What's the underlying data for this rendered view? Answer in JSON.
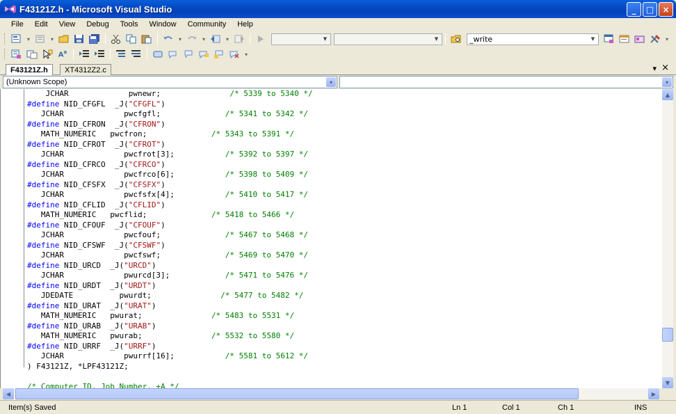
{
  "window": {
    "title": "F43121Z.h - Microsoft Visual Studio",
    "controls": [
      "_",
      "□",
      "×"
    ]
  },
  "menu": [
    "File",
    "Edit",
    "View",
    "Debug",
    "Tools",
    "Window",
    "Community",
    "Help"
  ],
  "toolbar1": {
    "find_combo_value": "_write"
  },
  "tabs": {
    "active": "F43121Z.h",
    "inactive": "XT4312Z2.c",
    "dropdown": "▾",
    "close": "×"
  },
  "scope": {
    "left_value": "(Unknown Scope)",
    "right_value": "",
    "dd_glyph": "▾"
  },
  "code_lines": [
    [
      [
        "",
        "    JCHAR             pwnewr;               "
      ],
      [
        "cmt",
        "/* 5339 to 5340 */"
      ]
    ],
    [
      [
        "kw",
        "#define"
      ],
      [
        "",
        " NID_CFGFL  _J("
      ],
      [
        "str",
        "\"CFGFL\""
      ],
      [
        "",
        ")"
      ]
    ],
    [
      [
        "",
        "   JCHAR             pwcfgfl;              "
      ],
      [
        "cmt",
        "/* 5341 to 5342 */"
      ]
    ],
    [
      [
        "kw",
        "#define"
      ],
      [
        "",
        " NID_CFRON  _J("
      ],
      [
        "str",
        "\"CFRON\""
      ],
      [
        "",
        ")"
      ]
    ],
    [
      [
        "",
        "   MATH_NUMERIC   pwcfron;              "
      ],
      [
        "cmt",
        "/* 5343 to 5391 */"
      ]
    ],
    [
      [
        "kw",
        "#define"
      ],
      [
        "",
        " NID_CFROT  _J("
      ],
      [
        "str",
        "\"CFROT\""
      ],
      [
        "",
        ")"
      ]
    ],
    [
      [
        "",
        "   JCHAR             pwcfrot[3];           "
      ],
      [
        "cmt",
        "/* 5392 to 5397 */"
      ]
    ],
    [
      [
        "kw",
        "#define"
      ],
      [
        "",
        " NID_CFRCO  _J("
      ],
      [
        "str",
        "\"CFRCO\""
      ],
      [
        "",
        ")"
      ]
    ],
    [
      [
        "",
        "   JCHAR             pwcfrco[6];           "
      ],
      [
        "cmt",
        "/* 5398 to 5409 */"
      ]
    ],
    [
      [
        "kw",
        "#define"
      ],
      [
        "",
        " NID_CFSFX  _J("
      ],
      [
        "str",
        "\"CFSFX\""
      ],
      [
        "",
        ")"
      ]
    ],
    [
      [
        "",
        "   JCHAR             pwcfsfx[4];           "
      ],
      [
        "cmt",
        "/* 5410 to 5417 */"
      ]
    ],
    [
      [
        "kw",
        "#define"
      ],
      [
        "",
        " NID_CFLID  _J("
      ],
      [
        "str",
        "\"CFLID\""
      ],
      [
        "",
        ")"
      ]
    ],
    [
      [
        "",
        "   MATH_NUMERIC   pwcflid;              "
      ],
      [
        "cmt",
        "/* 5418 to 5466 */"
      ]
    ],
    [
      [
        "kw",
        "#define"
      ],
      [
        "",
        " NID_CFOUF  _J("
      ],
      [
        "str",
        "\"CFOUF\""
      ],
      [
        "",
        ")"
      ]
    ],
    [
      [
        "",
        "   JCHAR             pwcfouf;              "
      ],
      [
        "cmt",
        "/* 5467 to 5468 */"
      ]
    ],
    [
      [
        "kw",
        "#define"
      ],
      [
        "",
        " NID_CFSWF  _J("
      ],
      [
        "str",
        "\"CFSWF\""
      ],
      [
        "",
        ")"
      ]
    ],
    [
      [
        "",
        "   JCHAR             pwcfswf;              "
      ],
      [
        "cmt",
        "/* 5469 to 5470 */"
      ]
    ],
    [
      [
        "kw",
        "#define"
      ],
      [
        "",
        " NID_URCD  _J("
      ],
      [
        "str",
        "\"URCD\""
      ],
      [
        "",
        ")"
      ]
    ],
    [
      [
        "",
        "   JCHAR             pwurcd[3];            "
      ],
      [
        "cmt",
        "/* 5471 to 5476 */"
      ]
    ],
    [
      [
        "kw",
        "#define"
      ],
      [
        "",
        " NID_URDT  _J("
      ],
      [
        "str",
        "\"URDT\""
      ],
      [
        "",
        ")"
      ]
    ],
    [
      [
        "",
        "   JDEDATE          pwurdt;               "
      ],
      [
        "cmt",
        "/* 5477 to 5482 */"
      ]
    ],
    [
      [
        "kw",
        "#define"
      ],
      [
        "",
        " NID_URAT  _J("
      ],
      [
        "str",
        "\"URAT\""
      ],
      [
        "",
        ")"
      ]
    ],
    [
      [
        "",
        "   MATH_NUMERIC   pwurat;               "
      ],
      [
        "cmt",
        "/* 5483 to 5531 */"
      ]
    ],
    [
      [
        "kw",
        "#define"
      ],
      [
        "",
        " NID_URAB  _J("
      ],
      [
        "str",
        "\"URAB\""
      ],
      [
        "",
        ")"
      ]
    ],
    [
      [
        "",
        "   MATH_NUMERIC   pwurab;               "
      ],
      [
        "cmt",
        "/* 5532 to 5580 */"
      ]
    ],
    [
      [
        "kw",
        "#define"
      ],
      [
        "",
        " NID_URRF  _J("
      ],
      [
        "str",
        "\"URRF\""
      ],
      [
        "",
        ")"
      ]
    ],
    [
      [
        "",
        "   JCHAR             pwurrf[16];           "
      ],
      [
        "cmt",
        "/* 5581 to 5612 */"
      ]
    ],
    [
      [
        "",
        ") F43121Z, *LPF43121Z;"
      ]
    ],
    [
      [
        "",
        ""
      ]
    ],
    [
      [
        "cmt",
        "/* Computer ID, Job Number, +A */"
      ]
    ]
  ],
  "status": {
    "message": "Item(s) Saved",
    "ln": "Ln 1",
    "col": "Col 1",
    "ch": "Ch 1",
    "mode": "INS"
  },
  "colors": {
    "keyword": "#0000ff",
    "string": "#a31515",
    "comment": "#008000",
    "titlebar": "#0449c4"
  },
  "icons": [
    "vs-logo-icon",
    "new-project-icon",
    "add-item-icon",
    "open-icon",
    "save-icon",
    "save-all-icon",
    "cut-icon",
    "copy-icon",
    "paste-icon",
    "undo-icon",
    "redo-icon",
    "nav-back-icon",
    "nav-forward-icon",
    "start-debug-icon",
    "find-in-files-icon",
    "solution-explorer-icon",
    "properties-icon",
    "object-browser-icon",
    "toolbox-icon"
  ]
}
